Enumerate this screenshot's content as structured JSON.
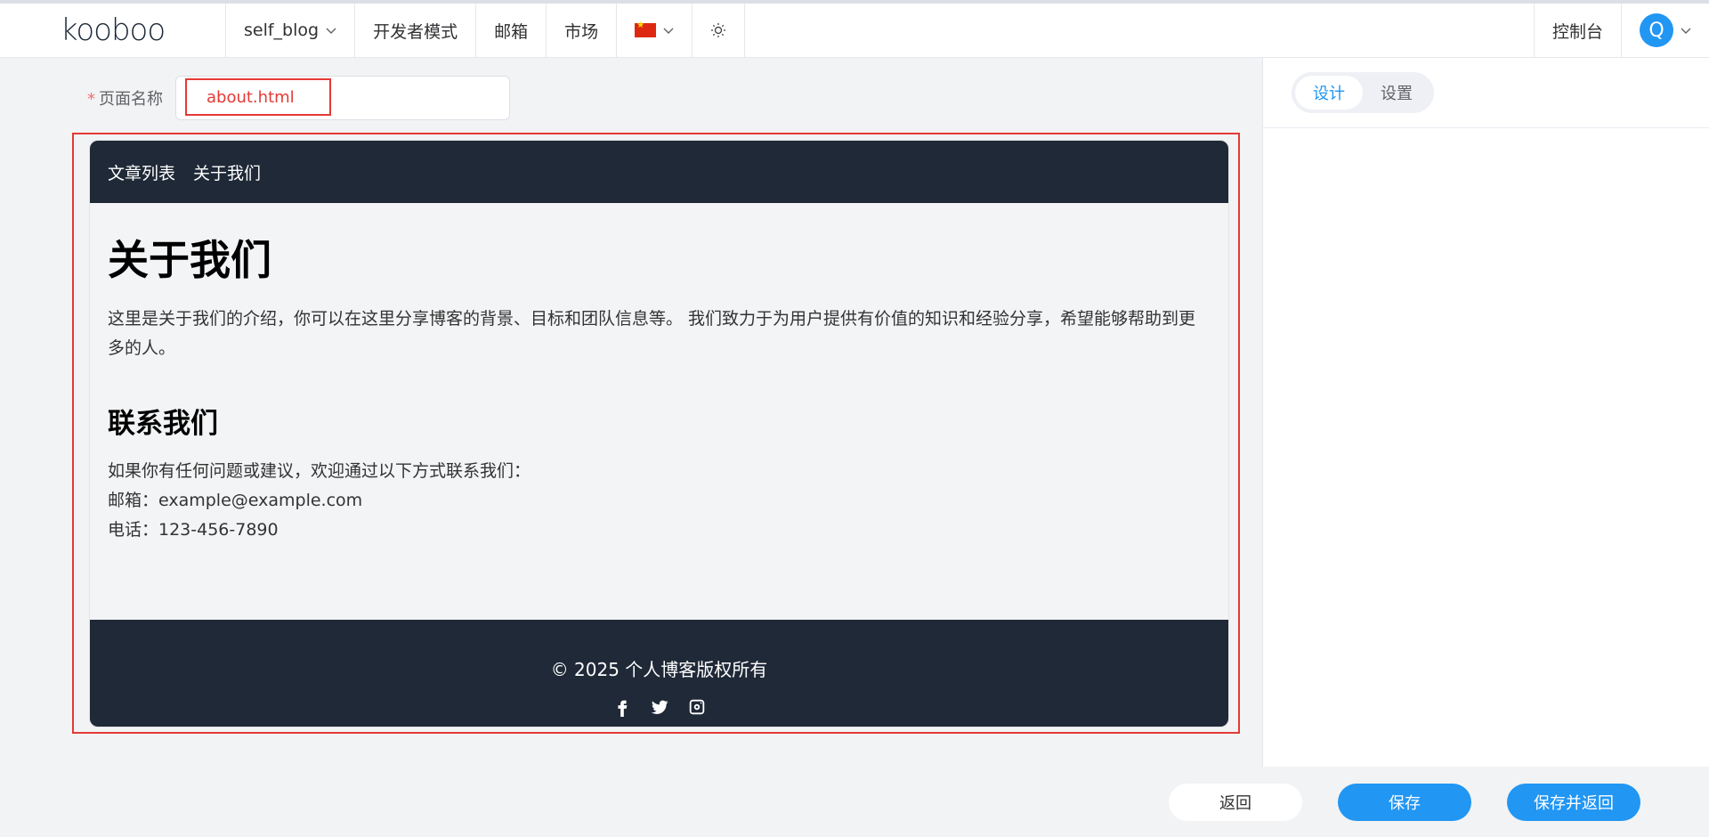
{
  "header": {
    "logo": "kooboo",
    "site_name": "self_blog",
    "dev_mode": "开发者模式",
    "mailbox": "邮箱",
    "market": "市场",
    "console": "控制台",
    "avatar_letter": "Q"
  },
  "form": {
    "required_mark": "*",
    "page_name_label": "页面名称",
    "page_name_value": "about.html"
  },
  "preview": {
    "nav": [
      "文章列表",
      "关于我们"
    ],
    "heading": "关于我们",
    "intro": "这里是关于我们的介绍，你可以在这里分享博客的背景、目标和团队信息等。 我们致力于为用户提供有价值的知识和经验分享，希望能够帮助到更多的人。",
    "contact_heading": "联系我们",
    "contact_intro": "如果你有任何问题或建议，欢迎通过以下方式联系我们：",
    "email_line": "邮箱：example@example.com",
    "phone_line": "电话：123-456-7890",
    "footer_copyright": "© 2025 个人博客版权所有",
    "social_icons": [
      "facebook-icon",
      "twitter-icon",
      "instagram-icon"
    ]
  },
  "side": {
    "tabs": [
      "设计",
      "设置"
    ],
    "active_tab": "设计"
  },
  "actions": {
    "back": "返回",
    "save": "保存",
    "save_and_back": "保存并返回"
  },
  "colors": {
    "accent": "#2196f3",
    "highlight": "#e53935",
    "dark": "#1f2937"
  }
}
